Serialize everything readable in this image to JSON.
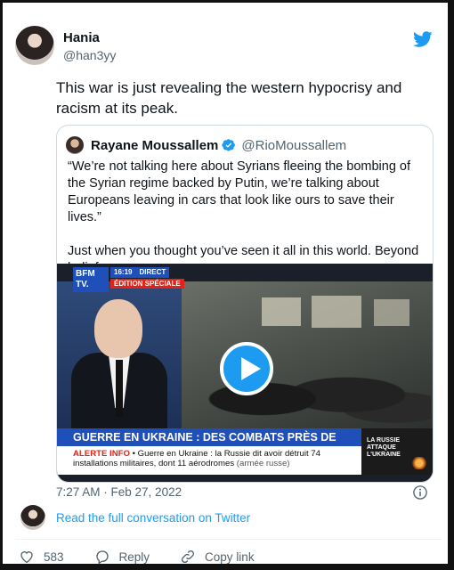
{
  "author": {
    "name": "Hania",
    "handle": "@han3yy"
  },
  "tweet": {
    "text": "This war is just revealing the western hypocrisy and racism at its peak."
  },
  "quoted": {
    "name": "Rayane Moussallem",
    "handle": "@RioMoussallem",
    "text": "“We’re not talking here about Syrians fleeing the bombing of the Syrian regime backed by Putin, we’re talking about Europeans leaving in cars that look like ours to save their lives.”\n\nJust when you thought you’ve seen it all in this world. Beyond belief.",
    "video": {
      "logo_line1": "BFM",
      "logo_line2": "TV.",
      "time": "16:19",
      "direct": "DIRECT",
      "edition": "ÉDITION SPÉCIALE",
      "headline": "GUERRE EN UKRAINE : DES COMBATS PRÈS DE KIEV",
      "alert_label": "ALERTE INFO",
      "alert_text": " • Guerre en Ukraine : la Russie dit avoir détruit 74 installations militaires, dont 11 aérodromes",
      "alert_source": " (armée russe)",
      "side_line1": "LA RUSSIE",
      "side_line2": "ATTAQUE",
      "side_line3": "L'UKRAINE"
    }
  },
  "meta": {
    "timestamp": "7:27 AM · Feb 27, 2022"
  },
  "conversation": {
    "link_text": "Read the full conversation on Twitter"
  },
  "actions": {
    "likes": "583",
    "reply_label": "Reply",
    "copy_label": "Copy link"
  },
  "colors": {
    "twitter_blue": "#1d9bf0",
    "text_primary": "#0f1419",
    "text_secondary": "#536471",
    "bfm_blue": "#1f4fb8",
    "bfm_red": "#e2231a"
  },
  "icons": [
    "twitter-bird-icon",
    "verified-badge-icon",
    "play-icon",
    "info-icon",
    "heart-icon",
    "reply-icon",
    "link-icon"
  ]
}
